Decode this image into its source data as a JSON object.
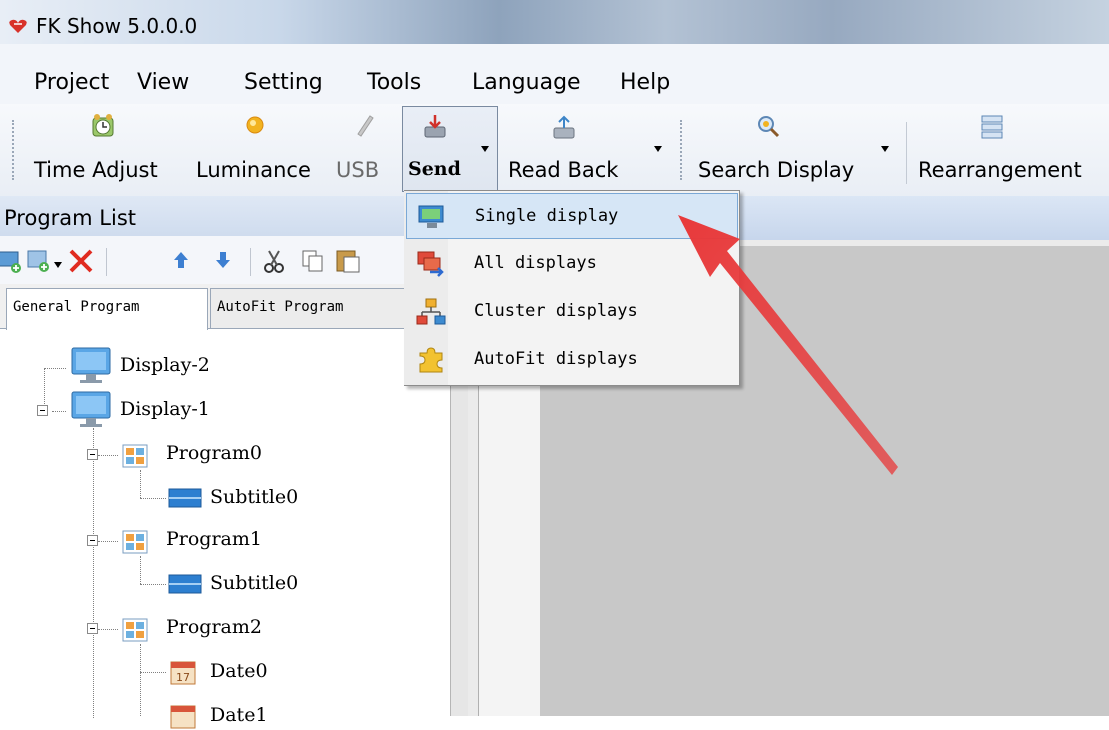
{
  "window": {
    "title": "FK Show 5.0.0.0"
  },
  "menu": {
    "items": [
      "Project",
      "View",
      "Setting",
      "Tools",
      "Language",
      "Help"
    ]
  },
  "toolbar": {
    "time_adjust": "Time Adjust",
    "luminance": "Luminance",
    "usb": "USB",
    "send": "Send",
    "read_back": "Read Back",
    "search_display": "Search Display",
    "rearrangement": "Rearrangement"
  },
  "program_list": {
    "title": "Program List",
    "tabs": [
      "General Program",
      "AutoFit Program"
    ]
  },
  "tree": {
    "display2": "Display-2",
    "display1": "Display-1",
    "program0": "Program0",
    "p0_subtitle": "Subtitle0",
    "program1": "Program1",
    "p1_subtitle": "Subtitle0",
    "program2": "Program2",
    "date0": "Date0",
    "date1": "Date1"
  },
  "send_menu": {
    "items": [
      "Single display",
      "All displays",
      "Cluster displays",
      "AutoFit displays"
    ],
    "highlighted": "Single display"
  },
  "colors": {
    "annotation_arrow": "#e8393a",
    "highlight": "#d6e6f6",
    "panel_header": "#cfdcee"
  }
}
